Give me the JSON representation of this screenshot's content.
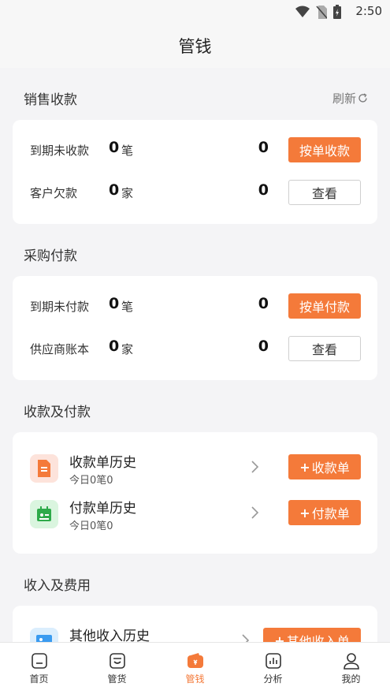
{
  "status_bar": {
    "time": "2:50"
  },
  "nav": {
    "title": "管钱"
  },
  "sales": {
    "title": "销售收款",
    "refresh_label": "刷新",
    "rows": [
      {
        "label": "到期未收款",
        "count": "0",
        "unit": "笔",
        "amount": "0",
        "button": "按单收款"
      },
      {
        "label": "客户欠款",
        "count": "0",
        "unit": "家",
        "amount": "0",
        "button": "查看"
      }
    ]
  },
  "purchase": {
    "title": "采购付款",
    "rows": [
      {
        "label": "到期未付款",
        "count": "0",
        "unit": "笔",
        "amount": "0",
        "button": "按单付款"
      },
      {
        "label": "供应商账本",
        "count": "0",
        "unit": "家",
        "amount": "0",
        "button": "查看"
      }
    ]
  },
  "receipts": {
    "title": "收款及付款",
    "items": [
      {
        "title": "收款单历史",
        "sub": "今日0笔0",
        "button": "收款单"
      },
      {
        "title": "付款单历史",
        "sub": "今日0笔0",
        "button": "付款单"
      }
    ]
  },
  "income": {
    "title": "收入及费用",
    "items": [
      {
        "title": "其他收入历史",
        "button": "其他收入单"
      }
    ]
  },
  "tabs": [
    {
      "label": "首页"
    },
    {
      "label": "管货"
    },
    {
      "label": "管钱"
    },
    {
      "label": "分析"
    },
    {
      "label": "我的"
    }
  ],
  "colors": {
    "accent": "#f47a3a",
    "background": "#f4f4f6"
  }
}
